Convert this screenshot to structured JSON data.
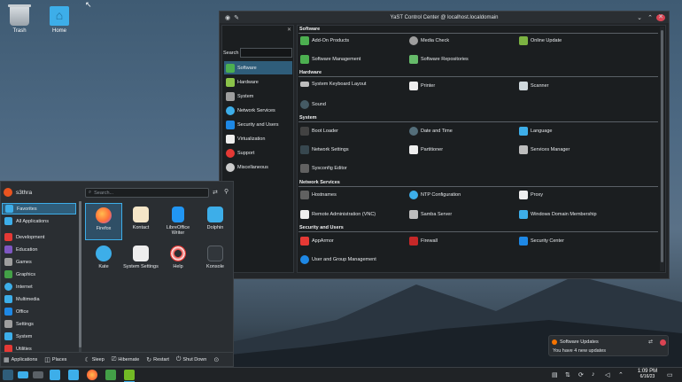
{
  "desktop": {
    "icons": [
      {
        "label": "Trash",
        "icon": "trash-icon"
      },
      {
        "label": "Home",
        "icon": "home-folder-icon"
      }
    ]
  },
  "yast": {
    "title": "YaST Control Center @ localhost.localdomain",
    "search_label": "Search",
    "categories": [
      {
        "label": "Software",
        "icon": "software-icon",
        "color": "#4caf50"
      },
      {
        "label": "Hardware",
        "icon": "hardware-icon",
        "color": "#8bc34a"
      },
      {
        "label": "System",
        "icon": "system-icon",
        "color": "#9e9e9e"
      },
      {
        "label": "Network Services",
        "icon": "globe-icon",
        "color": "#3daee9"
      },
      {
        "label": "Security and Users",
        "icon": "shield-icon",
        "color": "#1e88e5"
      },
      {
        "label": "Virtualization",
        "icon": "vm-icon",
        "color": "#eeeeee"
      },
      {
        "label": "Support",
        "icon": "lifebuoy-icon",
        "color": "#e53935"
      },
      {
        "label": "Miscellaneous",
        "icon": "misc-icon",
        "color": "#cccccc"
      }
    ],
    "sections": [
      {
        "title": "Software",
        "modules": [
          {
            "label": "Add-On Products",
            "icon": "addon-icon",
            "color": "#4caf50"
          },
          {
            "label": "Media Check",
            "icon": "disc-icon",
            "color": "#9e9e9e"
          },
          {
            "label": "Online Update",
            "icon": "update-icon",
            "color": "#7cb342"
          },
          {
            "label": "Software Management",
            "icon": "package-icon",
            "color": "#4caf50"
          },
          {
            "label": "Software Repositories",
            "icon": "repo-icon",
            "color": "#66bb6a"
          }
        ]
      },
      {
        "title": "Hardware",
        "modules": [
          {
            "label": "System Keyboard Layout",
            "icon": "keyboard-icon",
            "color": "#bdbdbd"
          },
          {
            "label": "Printer",
            "icon": "printer-icon",
            "color": "#eeeeee"
          },
          {
            "label": "Scanner",
            "icon": "scanner-icon",
            "color": "#cfd8dc"
          },
          {
            "label": "Sound",
            "icon": "speaker-icon",
            "color": "#455a64"
          }
        ]
      },
      {
        "title": "System",
        "modules": [
          {
            "label": "Boot Loader",
            "icon": "boot-icon",
            "color": "#424242"
          },
          {
            "label": "Date and Time",
            "icon": "clock-icon",
            "color": "#546e7a"
          },
          {
            "label": "Language",
            "icon": "language-icon",
            "color": "#3daee9"
          },
          {
            "label": "Network Settings",
            "icon": "network-icon",
            "color": "#37474f"
          },
          {
            "label": "Partitioner",
            "icon": "partition-icon",
            "color": "#eeeeee"
          },
          {
            "label": "Services Manager",
            "icon": "services-icon",
            "color": "#bdbdbd"
          },
          {
            "label": "Sysconfig Editor",
            "icon": "editor-icon",
            "color": "#616161"
          }
        ]
      },
      {
        "title": "Network Services",
        "modules": [
          {
            "label": "Hostnames",
            "icon": "hostnames-icon",
            "color": "#616161"
          },
          {
            "label": "NTP Configuration",
            "icon": "ntp-icon",
            "color": "#3daee9"
          },
          {
            "label": "Proxy",
            "icon": "proxy-icon",
            "color": "#eeeeee"
          },
          {
            "label": "Remote Administration (VNC)",
            "icon": "vnc-icon",
            "color": "#eeeeee"
          },
          {
            "label": "Samba Server",
            "icon": "samba-icon",
            "color": "#bdbdbd"
          },
          {
            "label": "Windows Domain Membership",
            "icon": "windows-icon",
            "color": "#3daee9"
          }
        ]
      },
      {
        "title": "Security and Users",
        "modules": [
          {
            "label": "AppArmor",
            "icon": "apparmor-icon",
            "color": "#e53935"
          },
          {
            "label": "Firewall",
            "icon": "firewall-icon",
            "color": "#c62828"
          },
          {
            "label": "Security Center",
            "icon": "security-center-icon",
            "color": "#1e88e5"
          },
          {
            "label": "User and Group Management",
            "icon": "users-icon",
            "color": "#1e88e5"
          }
        ]
      }
    ]
  },
  "launcher": {
    "username": "s3thra",
    "search_placeholder": "Search...",
    "categories": [
      {
        "label": "Favorites",
        "icon": "star-icon",
        "color": "#3daee9"
      },
      {
        "label": "All Applications",
        "icon": "grid-icon",
        "color": "#3daee9"
      },
      {
        "label": "Development",
        "icon": "development-icon",
        "color": "#e53935"
      },
      {
        "label": "Education",
        "icon": "education-icon",
        "color": "#7e57c2"
      },
      {
        "label": "Games",
        "icon": "games-icon",
        "color": "#9e9e9e"
      },
      {
        "label": "Graphics",
        "icon": "graphics-icon",
        "color": "#43a047"
      },
      {
        "label": "Internet",
        "icon": "internet-icon",
        "color": "#3daee9"
      },
      {
        "label": "Multimedia",
        "icon": "multimedia-icon",
        "color": "#3daee9"
      },
      {
        "label": "Office",
        "icon": "office-icon",
        "color": "#1e88e5"
      },
      {
        "label": "Settings",
        "icon": "settings-icon",
        "color": "#9e9e9e"
      },
      {
        "label": "System",
        "icon": "system-icon",
        "color": "#3daee9"
      },
      {
        "label": "Utilities",
        "icon": "utilities-icon",
        "color": "#e53935"
      }
    ],
    "apps": [
      {
        "label": "Firefox",
        "icon": "firefox-icon",
        "color": "#ff7139"
      },
      {
        "label": "Kontact",
        "icon": "kontact-icon",
        "color": "#f5e6c8"
      },
      {
        "label": "LibreOffice Writer",
        "icon": "writer-icon",
        "color": "#2196f3"
      },
      {
        "label": "Dolphin",
        "icon": "dolphin-icon",
        "color": "#3daee9"
      },
      {
        "label": "Kate",
        "icon": "kate-icon",
        "color": "#3daee9"
      },
      {
        "label": "System Settings",
        "icon": "settings-icon",
        "color": "#eeeeee"
      },
      {
        "label": "Help",
        "icon": "help-icon",
        "color": "#e53935"
      },
      {
        "label": "Konsole",
        "icon": "konsole-icon",
        "color": "#31363b"
      }
    ],
    "footer": {
      "applications": "Applications",
      "places": "Places",
      "sleep": "Sleep",
      "hibernate": "Hibernate",
      "restart": "Restart",
      "shutdown": "Shut Down"
    }
  },
  "notification": {
    "title": "Software Updates",
    "body": "You have 4 new updates"
  },
  "taskbar": {
    "time": "1:09 PM",
    "date": "6/16/23"
  }
}
